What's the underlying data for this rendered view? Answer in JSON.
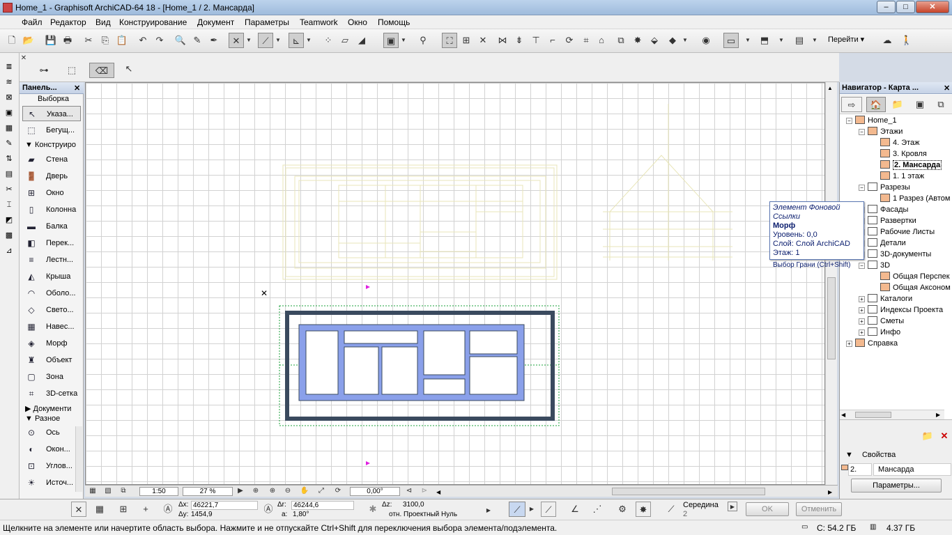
{
  "window": {
    "title": "Home_1 - Graphisoft ArchiCAD-64 18 - [Home_1 / 2. Мансарда]",
    "minimize": "–",
    "maximize": "□",
    "close": "✕"
  },
  "menu": [
    "Файл",
    "Редактор",
    "Вид",
    "Конструирование",
    "Документ",
    "Параметры",
    "Teamwork",
    "Окно",
    "Помощь"
  ],
  "toolbar": {
    "goto_label": "Перейти"
  },
  "toolbox": {
    "title": "Панель...",
    "close": "✕",
    "selection_heading": "Выборка",
    "tools_select": [
      {
        "icon": "cursor-arrow-icon",
        "label": "Указа..."
      },
      {
        "icon": "marquee-icon",
        "label": "Бегущ..."
      }
    ],
    "section_construct": "Конструиро",
    "tools_construct": [
      {
        "icon": "wall-icon",
        "label": "Стена"
      },
      {
        "icon": "door-icon",
        "label": "Дверь"
      },
      {
        "icon": "window-icon",
        "label": "Окно"
      },
      {
        "icon": "column-icon",
        "label": "Колонна"
      },
      {
        "icon": "beam-icon",
        "label": "Балка"
      },
      {
        "icon": "slab-icon",
        "label": "Перек..."
      },
      {
        "icon": "stair-icon",
        "label": "Лестн..."
      },
      {
        "icon": "roof-icon",
        "label": "Крыша"
      },
      {
        "icon": "shell-icon",
        "label": "Оболо..."
      },
      {
        "icon": "skylight-icon",
        "label": "Свето..."
      },
      {
        "icon": "curtain-wall-icon",
        "label": "Навес..."
      },
      {
        "icon": "morph-icon",
        "label": "Морф"
      },
      {
        "icon": "object-icon",
        "label": "Объект"
      },
      {
        "icon": "zone-icon",
        "label": "Зона"
      },
      {
        "icon": "mesh-icon",
        "label": "3D-сетка"
      }
    ],
    "section_document": "Документи",
    "section_misc": "Разное",
    "tools_misc": [
      {
        "icon": "grid-axis-icon",
        "label": "Ось"
      },
      {
        "icon": "wall-end-icon",
        "label": "Окон..."
      },
      {
        "icon": "corner-window-icon",
        "label": "Углов..."
      },
      {
        "icon": "lamp-icon",
        "label": "Источ..."
      }
    ]
  },
  "canvas_bar": {
    "scale": "1:50",
    "zoom": "27 %",
    "angle": "0,00°"
  },
  "navigator": {
    "title": "Навигатор - Карта ...",
    "close": "✕",
    "tree": [
      {
        "label": "Home_1",
        "level": 0
      },
      {
        "label": "Этажи",
        "level": 1
      },
      {
        "label": "4. Этаж",
        "level": 2
      },
      {
        "label": "3. Кровля",
        "level": 2
      },
      {
        "label": "2. Мансарда",
        "level": 2,
        "selected": true
      },
      {
        "label": "1. 1 этаж",
        "level": 2
      },
      {
        "label": "Разрезы",
        "level": 1
      },
      {
        "label": "1 Разрез (Автом",
        "level": 2
      },
      {
        "label": "Фасады",
        "level": 1
      },
      {
        "label": "Развертки",
        "level": 1
      },
      {
        "label": "Рабочие Листы",
        "level": 1
      },
      {
        "label": "Детали",
        "level": 1
      },
      {
        "label": "3D-документы",
        "level": 1
      },
      {
        "label": "3D",
        "level": 1
      },
      {
        "label": "Общая Перспек",
        "level": 2
      },
      {
        "label": "Общая Аксоном",
        "level": 2
      },
      {
        "label": "Каталоги",
        "level": 1
      },
      {
        "label": "Индексы Проекта",
        "level": 1
      },
      {
        "label": "Сметы",
        "level": 1
      },
      {
        "label": "Инфо",
        "level": 1
      },
      {
        "label": "Справка",
        "level": 0
      }
    ],
    "properties_label": "Свойства",
    "story_num": "2.",
    "story_name": "Мансарда",
    "params_button": "Параметры..."
  },
  "tooltip": {
    "line1": "Элемент Фоновой Ссылки",
    "line2": "Морф",
    "line3": "Уровень: 0,0",
    "line4": "Слой: Слой ArchiCAD",
    "line5": "Этаж: 1",
    "line6": "Выбор Грани (Ctrl+Shift)"
  },
  "infobar": {
    "dx_label": "Δx:",
    "dx": "46221,7",
    "dy_label": "Δy:",
    "dy": "1454,9",
    "dr_label": "Δr:",
    "dr": "46244,6",
    "da_label": "a:",
    "da": "1,80°",
    "dz_label": "Δz:",
    "dz": "3100,0",
    "ref": "отн. Проектный Нуль",
    "snap_label": "Середина",
    "snap_value": "2",
    "ok": "OK",
    "cancel": "Отменить"
  },
  "status": {
    "message": "Щелкните на элементе или начертите область выбора. Нажмите и не отпускайте Ctrl+Shift для переключения выбора элемента/подэлемента.",
    "disk": "C: 54.2 ГБ",
    "ram": "4.37 ГБ"
  },
  "colors": {
    "slab_fill": "#8aa0ea",
    "wall_dark": "#3a4a5e",
    "trace": "#e8e5b8",
    "selection": "#19a03a",
    "marker": "#e020e0"
  }
}
